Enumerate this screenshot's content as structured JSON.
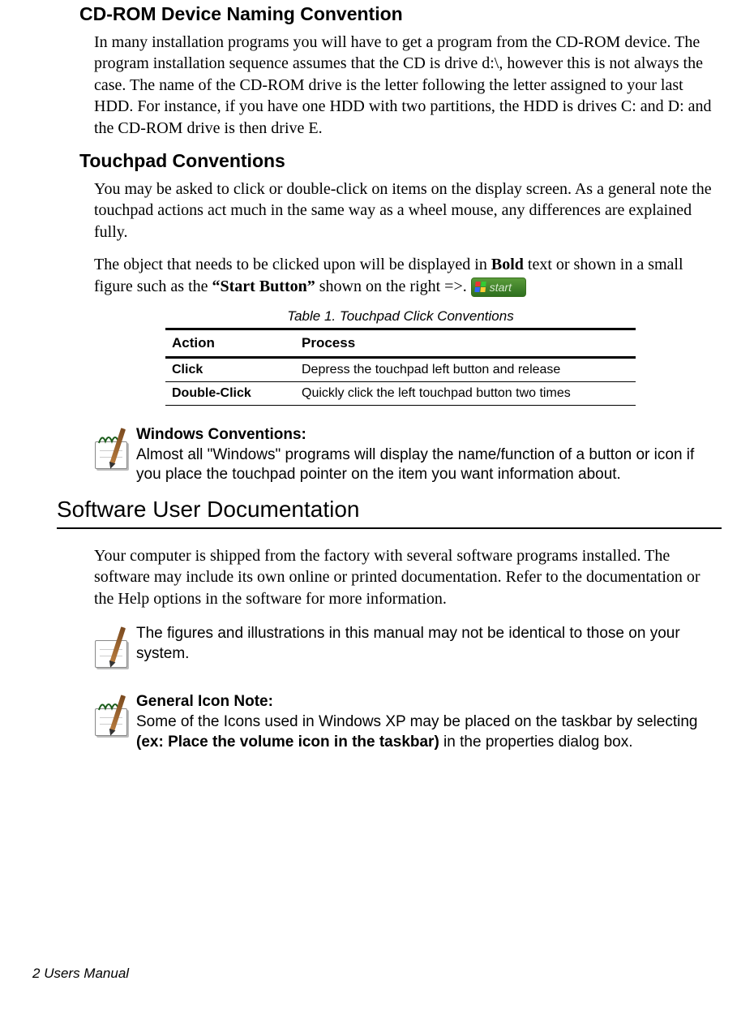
{
  "section1": {
    "heading": "CD-ROM Device Naming Convention",
    "para": "In many installation programs you will have to get a program from the CD-ROM device. The program installation sequence assumes that the CD is drive d:\\, however this is not always the case. The name of the CD-ROM drive is the letter following the letter assigned to your last HDD. For instance, if you have one HDD with two partitions, the HDD is drives C: and D: and the CD-ROM drive is then drive E."
  },
  "section2": {
    "heading": "Touchpad Conventions",
    "para1": "You may be asked to click or double-click on items on the display screen. As a general note the touchpad actions act much in the same way as a wheel mouse, any differences are explained fully.",
    "para2_pre": "The object that needs to be clicked upon will be displayed in ",
    "para2_bold1": "Bold",
    "para2_mid": " text or shown in a small figure such as the ",
    "para2_bold2": "“Start Button”",
    "para2_post1": " shown on the right =>.",
    "start_label": "start"
  },
  "table": {
    "caption": "Table 1.  Touchpad Click Conventions",
    "head_action": "Action",
    "head_process": "Process",
    "rows": [
      {
        "action": "Click",
        "process": "Depress the touchpad left button and release"
      },
      {
        "action": "Double-Click",
        "process": "Quickly click the left touchpad button two times"
      }
    ]
  },
  "note1": {
    "title": "Windows Conventions:",
    "text": "Almost all \"Windows\" programs will display the name/function of a button or icon if you place the touchpad pointer on the item you want information about."
  },
  "section3": {
    "heading": "Software User Documentation",
    "para": "Your computer is shipped from the factory with several software programs installed. The software may include its own online or printed documentation. Refer to the documentation or the Help options in the software for more information."
  },
  "note2": {
    "text": "The figures and illustrations in this manual may not be identical to those on your system."
  },
  "note3": {
    "title": "General Icon Note:",
    "pre": "Some of the Icons used in Windows XP may be placed on the taskbar by selecting ",
    "bold": "(ex: Place the volume icon in the taskbar)",
    "post": " in the properties dialog box."
  },
  "footer": {
    "page_num": "2",
    "label": "  Users Manual"
  }
}
